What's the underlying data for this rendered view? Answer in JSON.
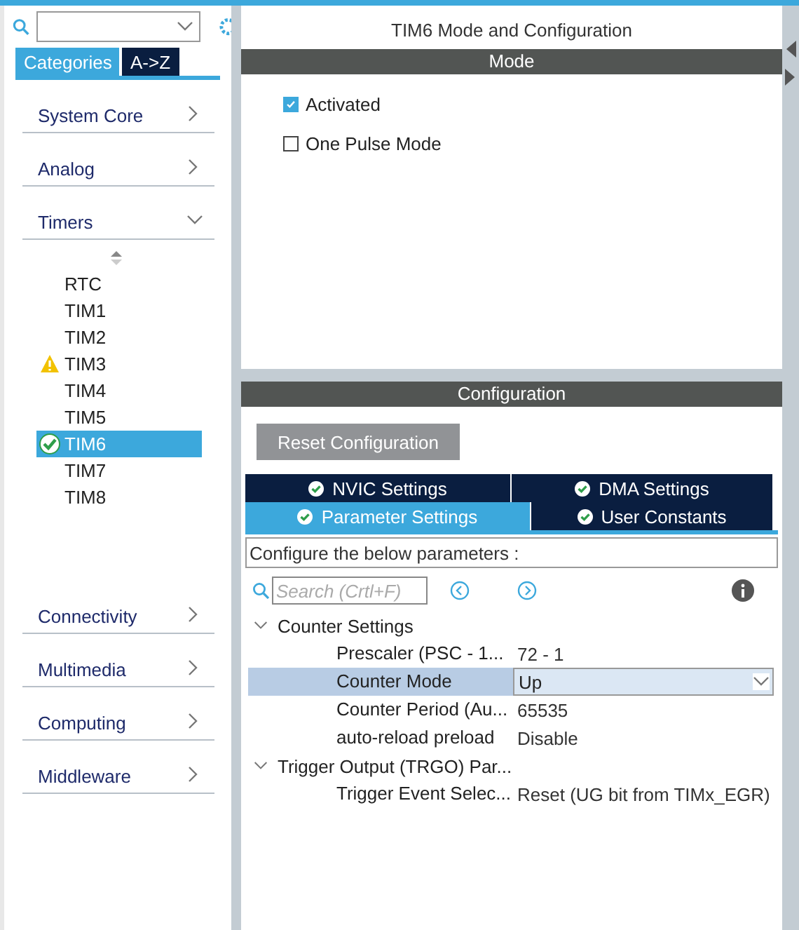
{
  "sidebar": {
    "tabs": [
      {
        "label": "Categories",
        "selected": true
      },
      {
        "label": "A->Z",
        "selected": false
      }
    ],
    "categories": [
      {
        "label": "System Core",
        "expanded": false
      },
      {
        "label": "Analog",
        "expanded": false
      },
      {
        "label": "Timers",
        "expanded": true,
        "children": [
          {
            "label": "RTC",
            "warning": false,
            "configured": false,
            "selected": false
          },
          {
            "label": "TIM1",
            "warning": false,
            "configured": false,
            "selected": false
          },
          {
            "label": "TIM2",
            "warning": false,
            "configured": false,
            "selected": false
          },
          {
            "label": "TIM3",
            "warning": true,
            "configured": false,
            "selected": false
          },
          {
            "label": "TIM4",
            "warning": false,
            "configured": false,
            "selected": false
          },
          {
            "label": "TIM5",
            "warning": false,
            "configured": false,
            "selected": false
          },
          {
            "label": "TIM6",
            "warning": false,
            "configured": true,
            "selected": true
          },
          {
            "label": "TIM7",
            "warning": false,
            "configured": false,
            "selected": false
          },
          {
            "label": "TIM8",
            "warning": false,
            "configured": false,
            "selected": false
          }
        ]
      },
      {
        "label": "Connectivity",
        "expanded": false
      },
      {
        "label": "Multimedia",
        "expanded": false
      },
      {
        "label": "Computing",
        "expanded": false
      },
      {
        "label": "Middleware",
        "expanded": false
      }
    ]
  },
  "main": {
    "title": "TIM6 Mode and Configuration",
    "mode": {
      "header": "Mode",
      "options": [
        {
          "label": "Activated",
          "checked": true
        },
        {
          "label": "One Pulse Mode",
          "checked": false
        }
      ]
    },
    "configuration": {
      "header": "Configuration",
      "reset_button": "Reset Configuration",
      "tabs": [
        [
          {
            "label": "NVIC Settings",
            "selected": false
          },
          {
            "label": "DMA Settings",
            "selected": false
          }
        ],
        [
          {
            "label": "Parameter Settings",
            "selected": true
          },
          {
            "label": "User Constants",
            "selected": false
          }
        ]
      ],
      "description": "Configure the below parameters :",
      "search": {
        "placeholder": "Search (Crtl+F)"
      },
      "groups": [
        {
          "label": "Counter Settings",
          "expanded": true,
          "params": [
            {
              "name": "Prescaler (PSC - 1...",
              "value": "72 - 1",
              "kind": "text",
              "selected": false
            },
            {
              "name": "Counter Mode",
              "value": "Up",
              "kind": "dropdown",
              "selected": true
            },
            {
              "name": "Counter Period (Au...",
              "value": "65535",
              "kind": "text",
              "selected": false
            },
            {
              "name": "auto-reload preload",
              "value": "Disable",
              "kind": "text",
              "selected": false
            }
          ]
        },
        {
          "label": "Trigger Output (TRGO) Par...",
          "expanded": true,
          "params": [
            {
              "name": "Trigger Event Selec...",
              "value": "Reset (UG bit from TIMx_EGR)",
              "kind": "text",
              "selected": false
            }
          ]
        }
      ]
    }
  }
}
